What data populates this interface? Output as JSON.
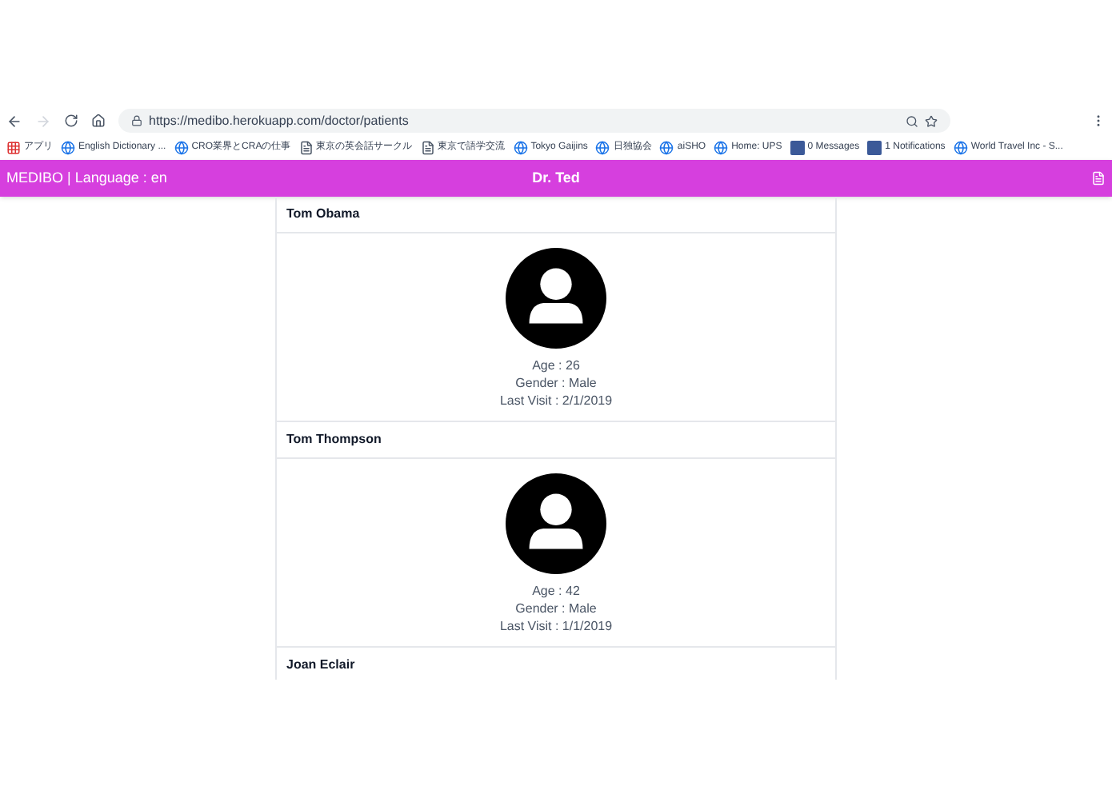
{
  "browser": {
    "url": "https://medibo.herokuapp.com/doctor/patients",
    "bookmarks": [
      {
        "label": "アプリ",
        "kind": "apps"
      },
      {
        "label": "English Dictionary ...",
        "kind": "site"
      },
      {
        "label": "CRO業界とCRAの仕事",
        "kind": "site"
      },
      {
        "label": "東京の英会話サークル",
        "kind": "page"
      },
      {
        "label": "東京で語学交流",
        "kind": "page"
      },
      {
        "label": "Tokyo Gaijins",
        "kind": "site"
      },
      {
        "label": "日独協会",
        "kind": "site"
      },
      {
        "label": "aiSHO",
        "kind": "site"
      },
      {
        "label": "Home: UPS",
        "kind": "site"
      },
      {
        "label": "0 Messages",
        "kind": "facebook"
      },
      {
        "label": "1 Notifications",
        "kind": "facebook"
      },
      {
        "label": "World Travel Inc - S...",
        "kind": "site"
      }
    ]
  },
  "header": {
    "brand": "MEDIBO | Language : en",
    "title": "Dr. Ted"
  },
  "patients": [
    {
      "name": "Tom Obama",
      "details": [
        "Age : 26",
        "Gender : Male",
        "Last Visit : 2/1/2019"
      ]
    },
    {
      "name": "Tom Thompson",
      "details": [
        "Age : 42",
        "Gender : Male",
        "Last Visit : 1/1/2019"
      ]
    },
    {
      "name": "Joan Eclair"
    }
  ]
}
